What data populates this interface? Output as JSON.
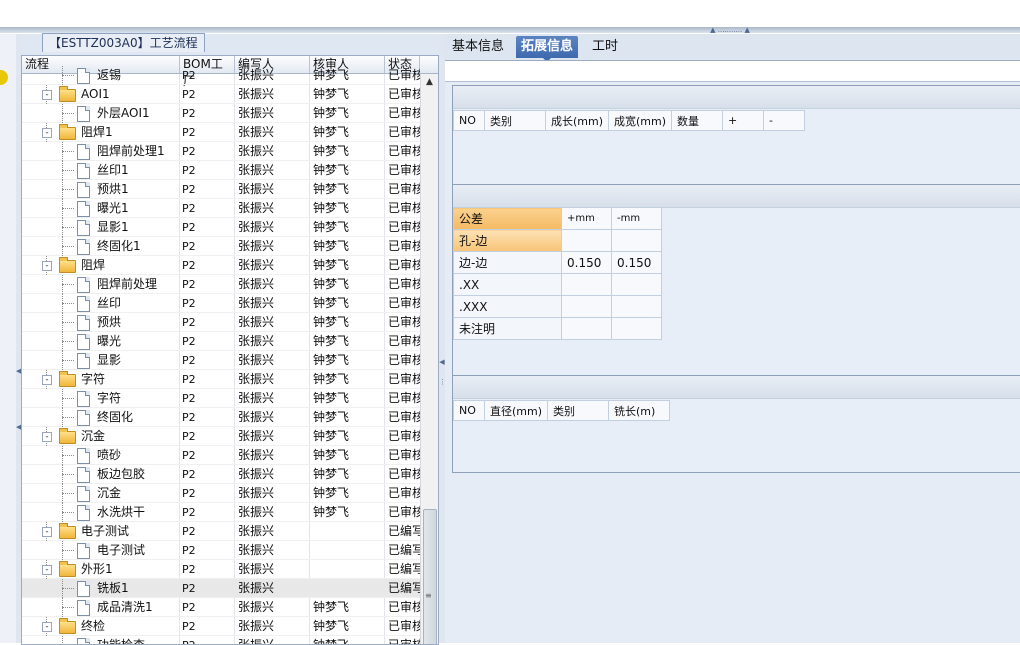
{
  "process_panel": {
    "title": "【ESTTZ003A0】工艺流程",
    "columns": [
      "流程",
      "BOM工厂",
      "编写人",
      "核审人",
      "状态"
    ],
    "rows": [
      {
        "level": 2,
        "kind": "doc",
        "name": "返锡",
        "bom": "P2",
        "writer": "张振兴",
        "reviewer": "钟梦飞",
        "status": "已审核",
        "partial": true
      },
      {
        "level": 1,
        "kind": "folder",
        "name": "AOI1",
        "bom": "P2",
        "writer": "张振兴",
        "reviewer": "钟梦飞",
        "status": "已审核"
      },
      {
        "level": 2,
        "kind": "doc",
        "name": "外层AOI1",
        "bom": "P2",
        "writer": "张振兴",
        "reviewer": "钟梦飞",
        "status": "已审核"
      },
      {
        "level": 1,
        "kind": "folder",
        "name": "阻焊1",
        "bom": "P2",
        "writer": "张振兴",
        "reviewer": "钟梦飞",
        "status": "已审核"
      },
      {
        "level": 2,
        "kind": "doc",
        "name": "阻焊前处理1",
        "bom": "P2",
        "writer": "张振兴",
        "reviewer": "钟梦飞",
        "status": "已审核"
      },
      {
        "level": 2,
        "kind": "doc",
        "name": "丝印1",
        "bom": "P2",
        "writer": "张振兴",
        "reviewer": "钟梦飞",
        "status": "已审核"
      },
      {
        "level": 2,
        "kind": "doc",
        "name": "预烘1",
        "bom": "P2",
        "writer": "张振兴",
        "reviewer": "钟梦飞",
        "status": "已审核"
      },
      {
        "level": 2,
        "kind": "doc",
        "name": "曝光1",
        "bom": "P2",
        "writer": "张振兴",
        "reviewer": "钟梦飞",
        "status": "已审核"
      },
      {
        "level": 2,
        "kind": "doc",
        "name": "显影1",
        "bom": "P2",
        "writer": "张振兴",
        "reviewer": "钟梦飞",
        "status": "已审核"
      },
      {
        "level": 2,
        "kind": "doc",
        "name": "终固化1",
        "bom": "P2",
        "writer": "张振兴",
        "reviewer": "钟梦飞",
        "status": "已审核"
      },
      {
        "level": 1,
        "kind": "folder",
        "name": "阻焊",
        "bom": "P2",
        "writer": "张振兴",
        "reviewer": "钟梦飞",
        "status": "已审核"
      },
      {
        "level": 2,
        "kind": "doc",
        "name": "阻焊前处理",
        "bom": "P2",
        "writer": "张振兴",
        "reviewer": "钟梦飞",
        "status": "已审核"
      },
      {
        "level": 2,
        "kind": "doc",
        "name": "丝印",
        "bom": "P2",
        "writer": "张振兴",
        "reviewer": "钟梦飞",
        "status": "已审核"
      },
      {
        "level": 2,
        "kind": "doc",
        "name": "预烘",
        "bom": "P2",
        "writer": "张振兴",
        "reviewer": "钟梦飞",
        "status": "已审核"
      },
      {
        "level": 2,
        "kind": "doc",
        "name": "曝光",
        "bom": "P2",
        "writer": "张振兴",
        "reviewer": "钟梦飞",
        "status": "已审核"
      },
      {
        "level": 2,
        "kind": "doc",
        "name": "显影",
        "bom": "P2",
        "writer": "张振兴",
        "reviewer": "钟梦飞",
        "status": "已审核"
      },
      {
        "level": 1,
        "kind": "folder",
        "name": "字符",
        "bom": "P2",
        "writer": "张振兴",
        "reviewer": "钟梦飞",
        "status": "已审核"
      },
      {
        "level": 2,
        "kind": "doc",
        "name": "字符",
        "bom": "P2",
        "writer": "张振兴",
        "reviewer": "钟梦飞",
        "status": "已审核"
      },
      {
        "level": 2,
        "kind": "doc",
        "name": "终固化",
        "bom": "P2",
        "writer": "张振兴",
        "reviewer": "钟梦飞",
        "status": "已审核"
      },
      {
        "level": 1,
        "kind": "folder",
        "name": "沉金",
        "bom": "P2",
        "writer": "张振兴",
        "reviewer": "钟梦飞",
        "status": "已审核"
      },
      {
        "level": 2,
        "kind": "doc",
        "name": "喷砂",
        "bom": "P2",
        "writer": "张振兴",
        "reviewer": "钟梦飞",
        "status": "已审核"
      },
      {
        "level": 2,
        "kind": "doc",
        "name": "板边包胶",
        "bom": "P2",
        "writer": "张振兴",
        "reviewer": "钟梦飞",
        "status": "已审核"
      },
      {
        "level": 2,
        "kind": "doc",
        "name": "沉金",
        "bom": "P2",
        "writer": "张振兴",
        "reviewer": "钟梦飞",
        "status": "已审核"
      },
      {
        "level": 2,
        "kind": "doc",
        "name": "水洗烘干",
        "bom": "P2",
        "writer": "张振兴",
        "reviewer": "钟梦飞",
        "status": "已审核"
      },
      {
        "level": 1,
        "kind": "folder",
        "name": "电子测试",
        "bom": "P2",
        "writer": "张振兴",
        "reviewer": "",
        "status": "已编写"
      },
      {
        "level": 2,
        "kind": "doc",
        "name": "电子测试",
        "bom": "P2",
        "writer": "张振兴",
        "reviewer": "",
        "status": "已编写"
      },
      {
        "level": 1,
        "kind": "folder",
        "name": "外形1",
        "bom": "P2",
        "writer": "张振兴",
        "reviewer": "",
        "status": "已编写"
      },
      {
        "level": 2,
        "kind": "doc",
        "name": "铣板1",
        "bom": "P2",
        "writer": "张振兴",
        "reviewer": "",
        "status": "已编写",
        "selected": true
      },
      {
        "level": 2,
        "kind": "doc",
        "name": "成品清洗1",
        "bom": "P2",
        "writer": "张振兴",
        "reviewer": "钟梦飞",
        "status": "已审核"
      },
      {
        "level": 1,
        "kind": "folder",
        "name": "终检",
        "bom": "P2",
        "writer": "张振兴",
        "reviewer": "钟梦飞",
        "status": "已审核"
      },
      {
        "level": 2,
        "kind": "doc",
        "name": "功能检查",
        "bom": "P2",
        "writer": "张振兴",
        "reviewer": "钟梦飞",
        "status": "已审核",
        "partial": true
      }
    ]
  },
  "tabs": [
    {
      "label": "基本信息",
      "active": false
    },
    {
      "label": "拓展信息",
      "active": true
    },
    {
      "label": "工时",
      "active": false
    }
  ],
  "size_table": {
    "headers": [
      "NO",
      "类别",
      "成长(mm)",
      "成宽(mm)",
      "数量",
      "+",
      "-"
    ]
  },
  "tolerance_table": {
    "header": [
      "公差",
      "+mm",
      "-mm"
    ],
    "rows": [
      {
        "label": "孔-边",
        "plus": "",
        "minus": "",
        "highlight": true
      },
      {
        "label": "边-边",
        "plus": "0.150",
        "minus": "0.150"
      },
      {
        "label": ".XX",
        "plus": "",
        "minus": ""
      },
      {
        "label": ".XXX",
        "plus": "",
        "minus": ""
      },
      {
        "label": "未注明",
        "plus": "",
        "minus": ""
      }
    ]
  },
  "milling_table": {
    "headers": [
      "NO",
      "直径(mm)",
      "类别",
      "铣长(m)"
    ]
  },
  "colors": {
    "selected_tab": "#3e6aae",
    "tolerance_header": "#f5b964",
    "folder": "#f0b63a"
  }
}
